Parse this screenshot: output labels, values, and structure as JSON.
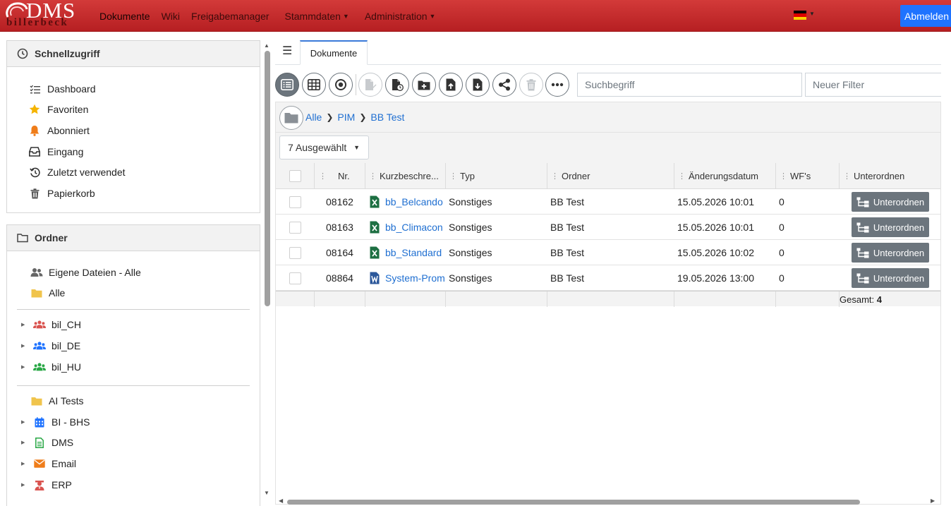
{
  "logo": {
    "brand": "DMS",
    "sub": "billerbeck"
  },
  "nav": {
    "items": [
      {
        "label": "Dokumente"
      },
      {
        "label": "Wiki"
      },
      {
        "label": "Freigabemanager"
      },
      {
        "label": "Stammdaten"
      },
      {
        "label": "Administration"
      }
    ],
    "logout_label": "Abmelden"
  },
  "quick": {
    "title": "Schnellzugriff",
    "items": [
      {
        "label": "Dashboard",
        "icon": "list-check-icon"
      },
      {
        "label": "Favoriten",
        "icon": "star-icon"
      },
      {
        "label": "Abonniert",
        "icon": "bell-icon"
      },
      {
        "label": "Eingang",
        "icon": "inbox-icon"
      },
      {
        "label": "Zuletzt verwendet",
        "icon": "history-icon"
      },
      {
        "label": "Papierkorb",
        "icon": "trash-icon"
      }
    ]
  },
  "folders": {
    "title": "Ordner",
    "top": [
      {
        "label": "Eigene Dateien - Alle",
        "icon": "users-icon"
      },
      {
        "label": "Alle",
        "icon": "folder-icon"
      }
    ],
    "groups": [
      {
        "label": "bil_CH",
        "icon": "users-icon",
        "color": "#d9534f"
      },
      {
        "label": "bil_DE",
        "icon": "users-icon",
        "color": "#1f73ff"
      },
      {
        "label": "bil_HU",
        "icon": "users-icon",
        "color": "#28a745"
      }
    ],
    "more": [
      {
        "label": "AI Tests",
        "icon": "folder-icon"
      },
      {
        "label": "BI - BHS",
        "icon": "calendar-icon"
      },
      {
        "label": "DMS",
        "icon": "file-text-icon"
      },
      {
        "label": "Email",
        "icon": "envelope-icon"
      },
      {
        "label": "ERP",
        "icon": "user-tie-icon"
      }
    ]
  },
  "tabs": {
    "active": "Dokumente"
  },
  "search": {
    "placeholder": "Suchbegriff",
    "filter_placeholder": "Neuer Filter"
  },
  "breadcrumb": {
    "items": [
      "Alle",
      "PIM",
      "BB Test"
    ]
  },
  "selection": {
    "label": "7 Ausgewählt"
  },
  "table": {
    "columns": [
      "Nr.",
      "Kurzbeschre...",
      "Typ",
      "Ordner",
      "Änderungsdatum",
      "WF's",
      "Unterordnen"
    ],
    "rows": [
      {
        "nr": "08162",
        "name": "bb_Belcando",
        "type": "Sonstiges",
        "folder": "BB Test",
        "date": "15.05.2026 10:01",
        "wf": "0",
        "action": "Unterordnen",
        "filetype": "excel"
      },
      {
        "nr": "08163",
        "name": "bb_Climacon",
        "type": "Sonstiges",
        "folder": "BB Test",
        "date": "15.05.2026 10:01",
        "wf": "0",
        "action": "Unterordnen",
        "filetype": "excel"
      },
      {
        "nr": "08164",
        "name": "bb_Standard",
        "type": "Sonstiges",
        "folder": "BB Test",
        "date": "15.05.2026 10:02",
        "wf": "0",
        "action": "Unterordnen",
        "filetype": "excel"
      },
      {
        "nr": "08864",
        "name": "System-Prom",
        "type": "Sonstiges",
        "folder": "BB Test",
        "date": "19.05.2026 13:00",
        "wf": "0",
        "action": "Unterordnen",
        "filetype": "word"
      }
    ],
    "total_label": "Gesamt:",
    "total_value": "4"
  },
  "colors": {
    "navbar": "#c62a2c",
    "primary": "#1f73ff",
    "excel": "#1d6f42",
    "word": "#2b579a"
  }
}
